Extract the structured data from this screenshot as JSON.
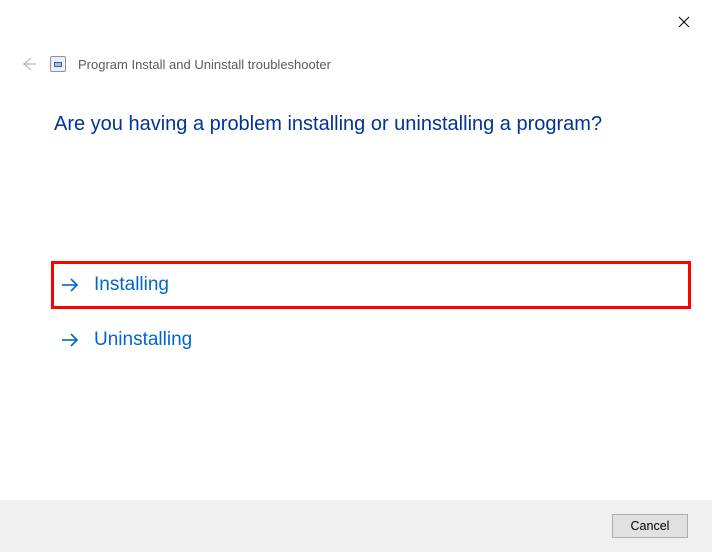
{
  "header": {
    "title": "Program Install and Uninstall troubleshooter"
  },
  "main": {
    "question": "Are you having a problem installing or uninstalling a program?",
    "options": {
      "installing_label": "Installing",
      "uninstalling_label": "Uninstalling"
    }
  },
  "footer": {
    "cancel_label": "Cancel"
  }
}
